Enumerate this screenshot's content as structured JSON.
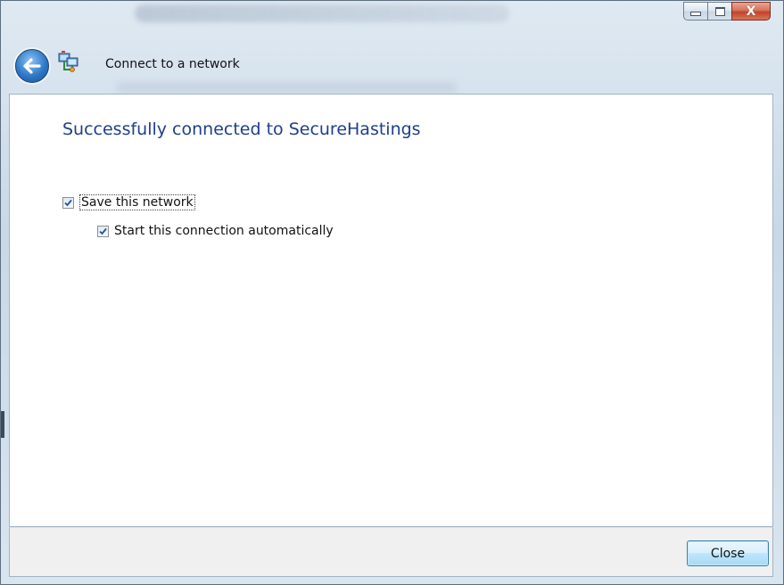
{
  "window": {
    "caption": {
      "minimize_icon": "minimize-icon",
      "maximize_icon": "maximize-icon",
      "close_glyph": "X"
    },
    "header": {
      "back_icon": "back-arrow-icon",
      "network_icon": "network-icon",
      "title": "Connect to a network"
    }
  },
  "content": {
    "success_message": "Successfully connected to SecureHastings",
    "save_network": {
      "label": "Save this network",
      "checked": true
    },
    "start_automatically": {
      "label": "Start this connection automatically",
      "checked": true
    }
  },
  "footer": {
    "close_label": "Close"
  },
  "colors": {
    "title_blue": "#1e3f8a",
    "close_red": "#c2432a",
    "button_blue": "#bee6fd"
  }
}
